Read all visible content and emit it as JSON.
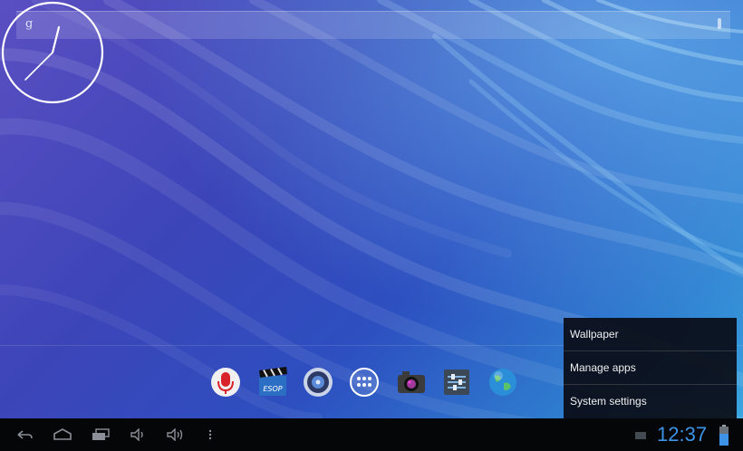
{
  "search_bar": {
    "google_glyph": "g"
  },
  "dock": {
    "apps": [
      {
        "name": "voice-search",
        "icon": "microphone-icon"
      },
      {
        "name": "video-player",
        "icon": "clapperboard-icon"
      },
      {
        "name": "music",
        "icon": "speaker-icon"
      },
      {
        "name": "app-drawer",
        "icon": "grid-dots-icon"
      },
      {
        "name": "camera",
        "icon": "camera-icon"
      },
      {
        "name": "settings",
        "icon": "sliders-icon"
      },
      {
        "name": "browser",
        "icon": "globe-icon"
      }
    ]
  },
  "context_menu": {
    "items": [
      "Wallpaper",
      "Manage apps",
      "System settings"
    ]
  },
  "status_bar": {
    "time": "12:37",
    "accent_color": "#3d93e6"
  }
}
